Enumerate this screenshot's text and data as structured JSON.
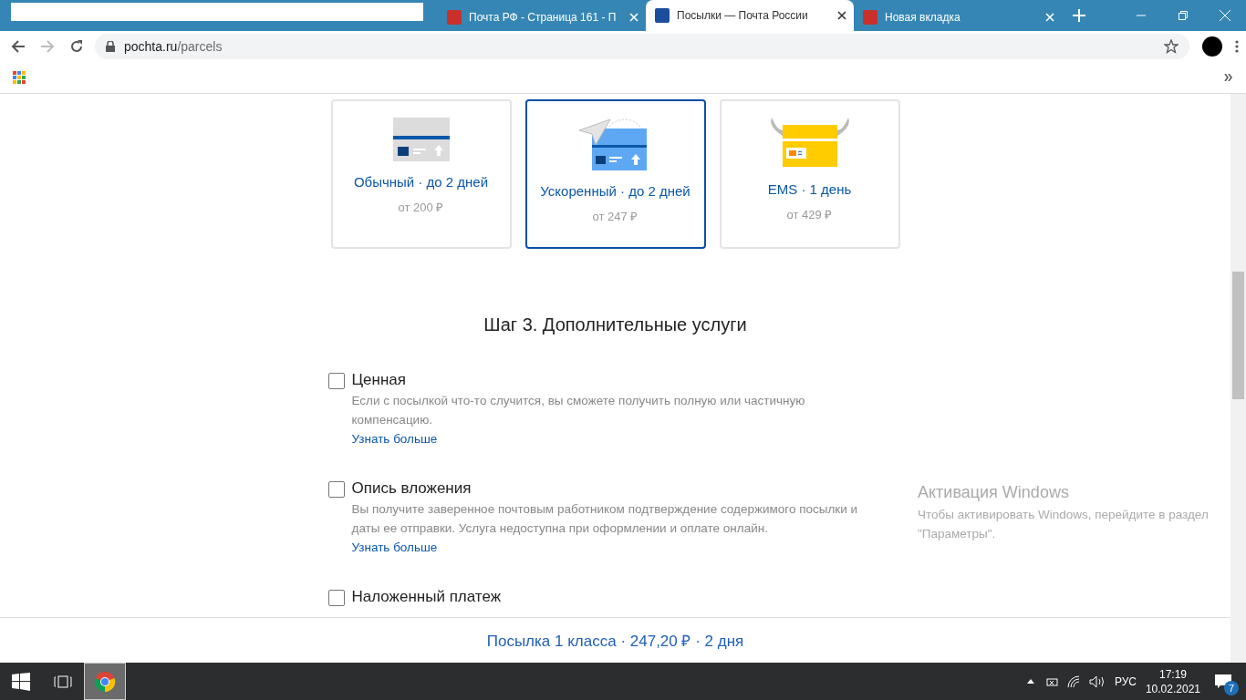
{
  "browser": {
    "tabs": [
      {
        "title": "Почта РФ - Страница 161 - П",
        "selected": false
      },
      {
        "title": "Посылки — Почта России",
        "selected": true
      },
      {
        "title": "Новая вкладка",
        "selected": false
      }
    ],
    "url_host": "pochta.ru",
    "url_path": "/parcels"
  },
  "shipping_options": [
    {
      "kind": "regular",
      "title": "Обычный · до 2 дней",
      "price": "от 200 ₽",
      "selected": false
    },
    {
      "kind": "express",
      "title": "Ускоренный · до 2 дней",
      "price": "от 247 ₽",
      "selected": true
    },
    {
      "kind": "ems",
      "title": "EMS · 1 день",
      "price": "от 429 ₽",
      "selected": false
    }
  ],
  "step_heading": "Шаг 3. Дополнительные услуги",
  "services": [
    {
      "label": "Ценная",
      "checked": false,
      "description": "Если с посылкой что-то случится, вы сможете получить полную или частичную компенсацию.",
      "link": "Узнать больше"
    },
    {
      "label": "Опись вложения",
      "checked": false,
      "description": "Вы получите заверенное почтовым работником подтверждение содержимого посылки и даты ее отправки. Услуга недоступна при оформлении и оплате онлайн.",
      "link": "Узнать больше"
    },
    {
      "label": "Наложенный платеж",
      "checked": false
    }
  ],
  "summary": "Посылка 1 класса · 247,20 ₽ · 2 дня",
  "activation": {
    "title": "Активация Windows",
    "text": "Чтобы активировать Windows, перейдите в раздел \"Параметры\"."
  },
  "taskbar": {
    "language": "РУС",
    "time": "17:19",
    "date": "10.02.2021",
    "notifications": "7"
  }
}
